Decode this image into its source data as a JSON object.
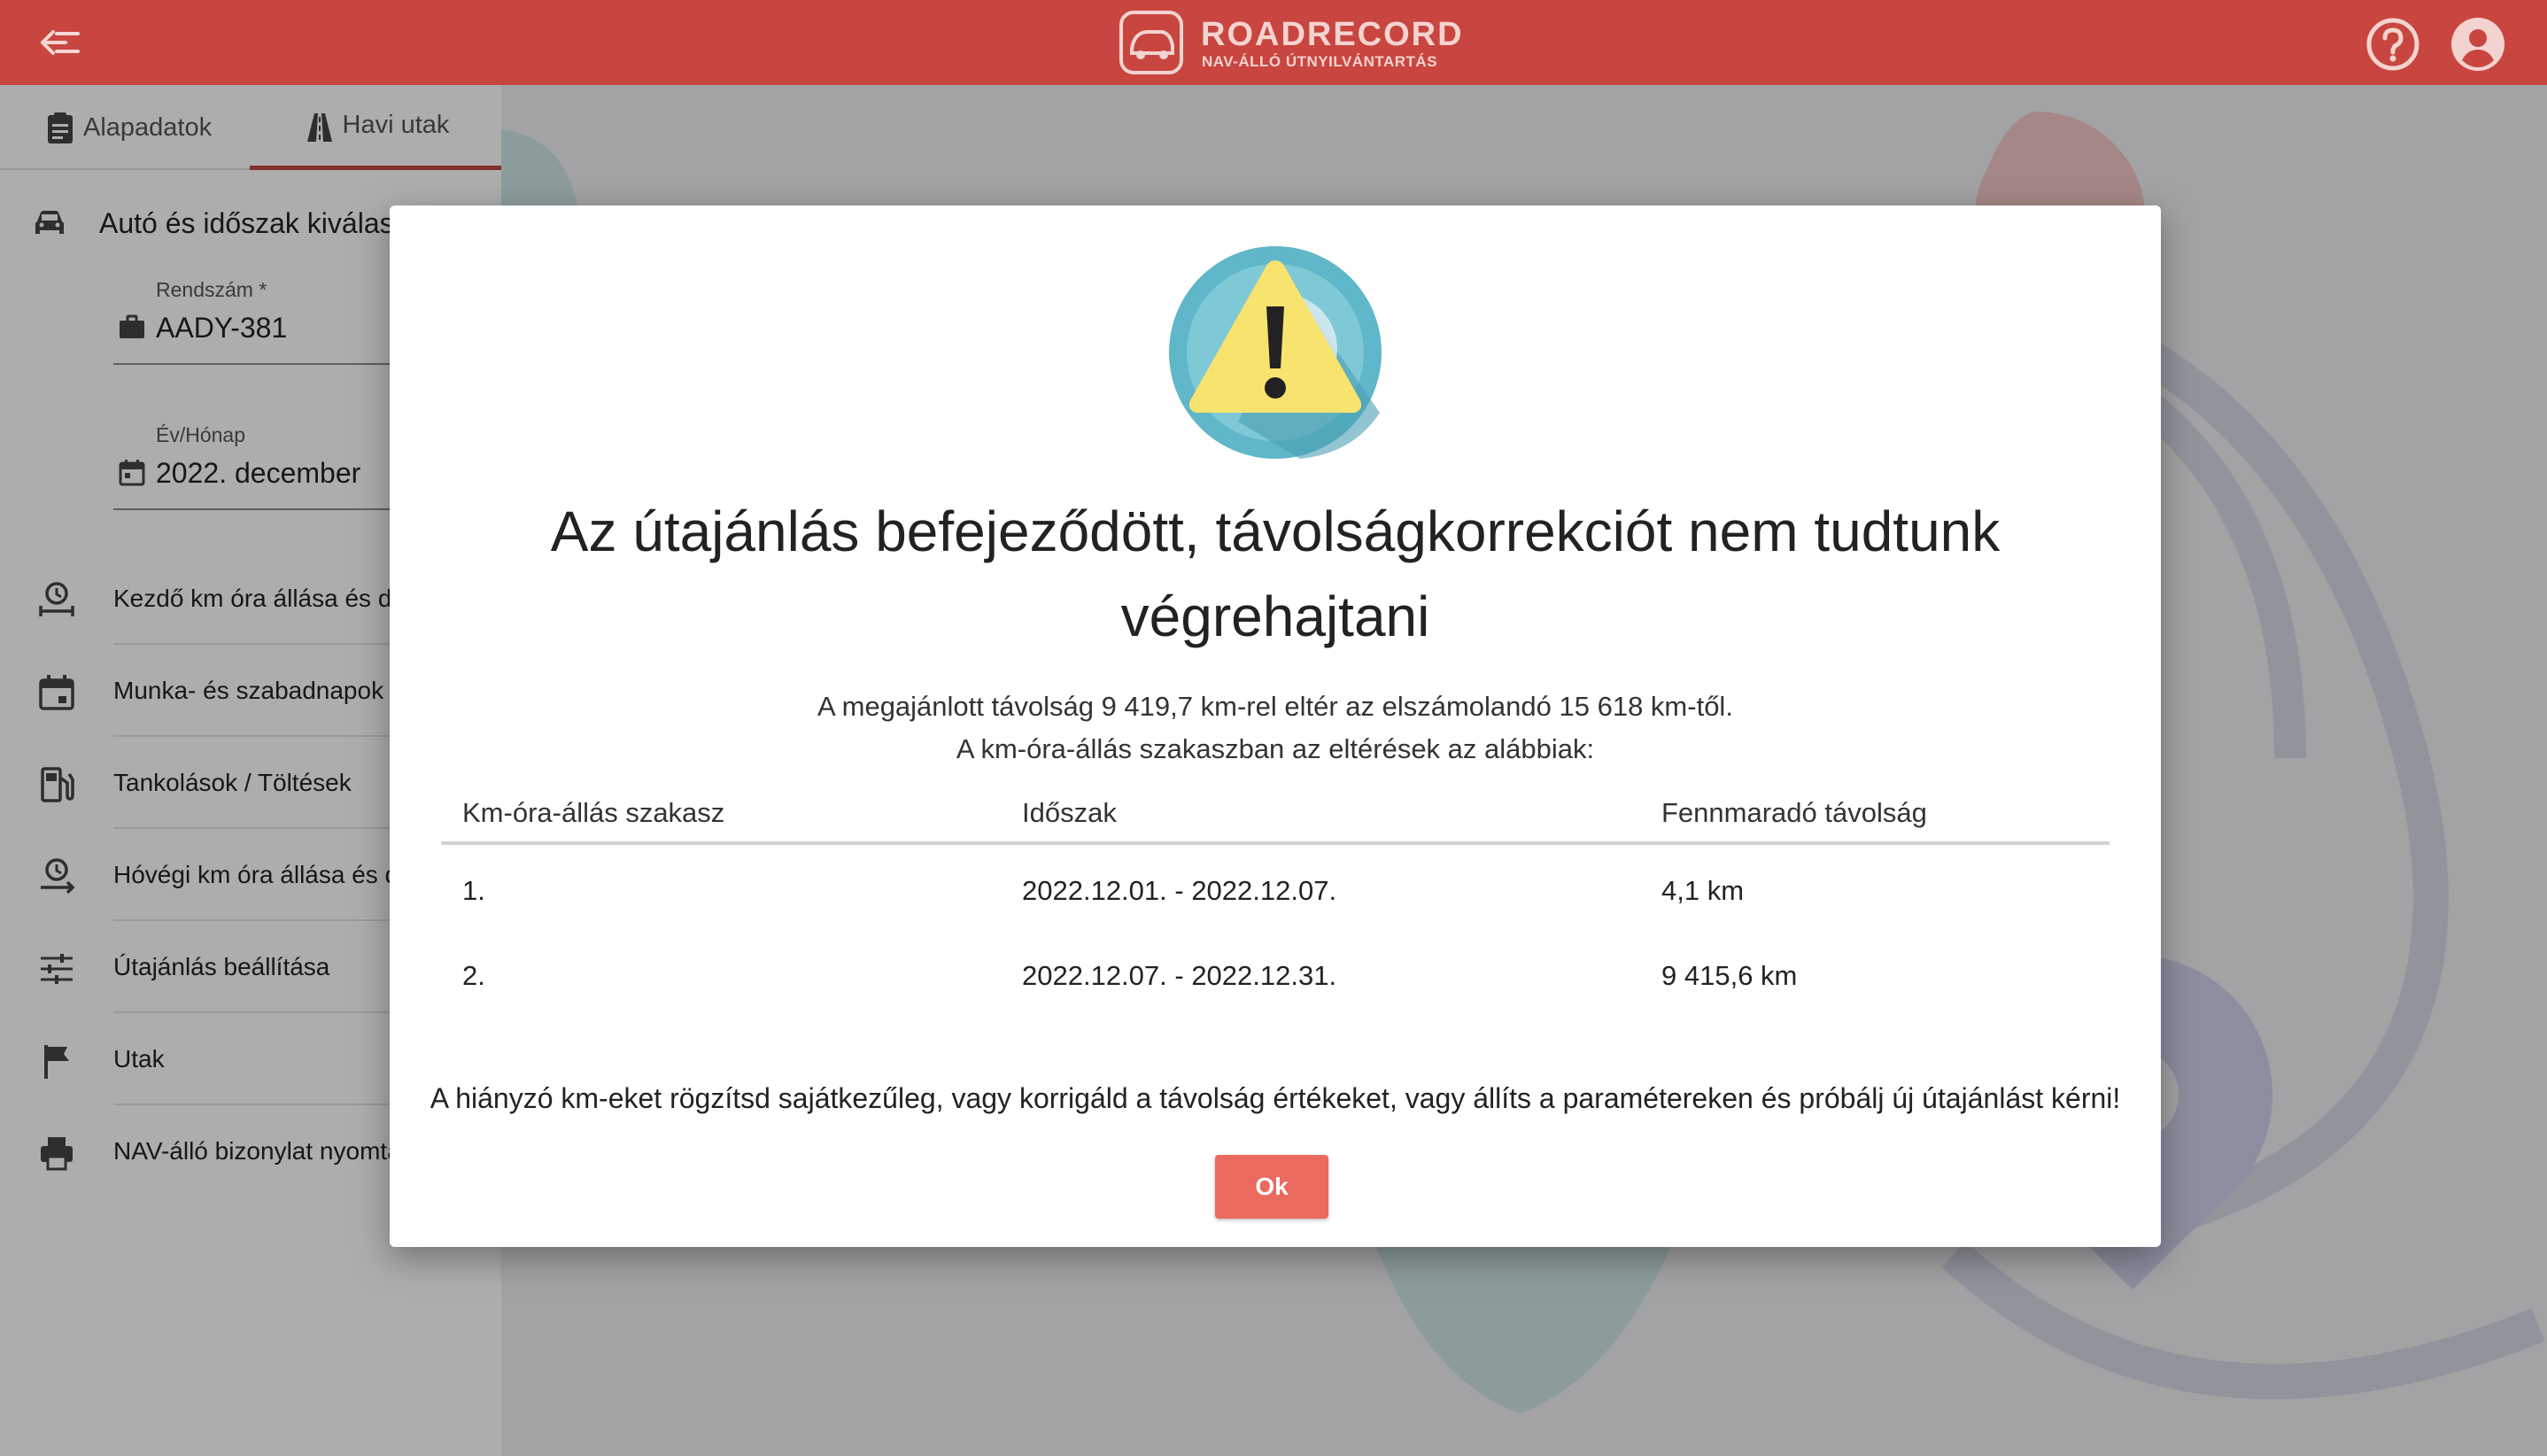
{
  "header": {
    "logo_title": "ROADRECORD",
    "logo_subtitle": "NAV-ÁLLÓ ÚTNYILVÁNTARTÁS",
    "color": "#c8463f"
  },
  "sidebar": {
    "tabs": [
      {
        "label": "Alapadatok",
        "icon": "clipboard-icon"
      },
      {
        "label": "Havi utak",
        "icon": "road-icon",
        "active": true
      }
    ],
    "section_title": "Autó és időszak kiválasztása",
    "fields": {
      "plate": {
        "label": "Rendszám *",
        "value": "AADY-381"
      },
      "month": {
        "label": "Év/Hónap",
        "value": "2022. december"
      }
    },
    "menu": [
      {
        "label": "Kezdő km óra állása és dátuma",
        "icon": "clock-distance-icon"
      },
      {
        "label": "Munka- és szabadnapok",
        "icon": "calendar-icon"
      },
      {
        "label": "Tankolások / Töltések",
        "icon": "fuel-pump-icon"
      },
      {
        "label": "Hóvégi km óra állása és dátuma",
        "icon": "clock-distance-icon"
      },
      {
        "label": "Útajánlás beállítása",
        "icon": "tune-icon"
      },
      {
        "label": "Utak",
        "icon": "flag-icon"
      },
      {
        "label": "NAV-álló bizonylat nyomtatása",
        "icon": "printer-icon"
      }
    ]
  },
  "dialog": {
    "icon": "warning-icon",
    "title": "Az útajánlás befejeződött, távolságkorrekciót nem tudtunk végrehajtani",
    "message_line1": "A megajánlott távolság 9 419,7 km-rel eltér az elszámolandó 15 618 km-től.",
    "message_line2": "A km-óra-állás szakaszban az eltérések az alábbiak:",
    "table": {
      "headers": [
        "Km-óra-állás szakasz",
        "Időszak",
        "Fennmaradó távolság"
      ],
      "rows": [
        [
          "1.",
          "2022.12.01. - 2022.12.07.",
          "4,1 km"
        ],
        [
          "2.",
          "2022.12.07. - 2022.12.31.",
          "9 415,6 km"
        ]
      ]
    },
    "footer_note": "A hiányzó km-eket rögzítsd sajátkezűleg, vagy korrigáld a távolság értékeket, vagy állíts a paramétereken és próbálj új útajánlást kérni!",
    "ok_label": "Ok",
    "ok_color": "#eb6a5f"
  }
}
